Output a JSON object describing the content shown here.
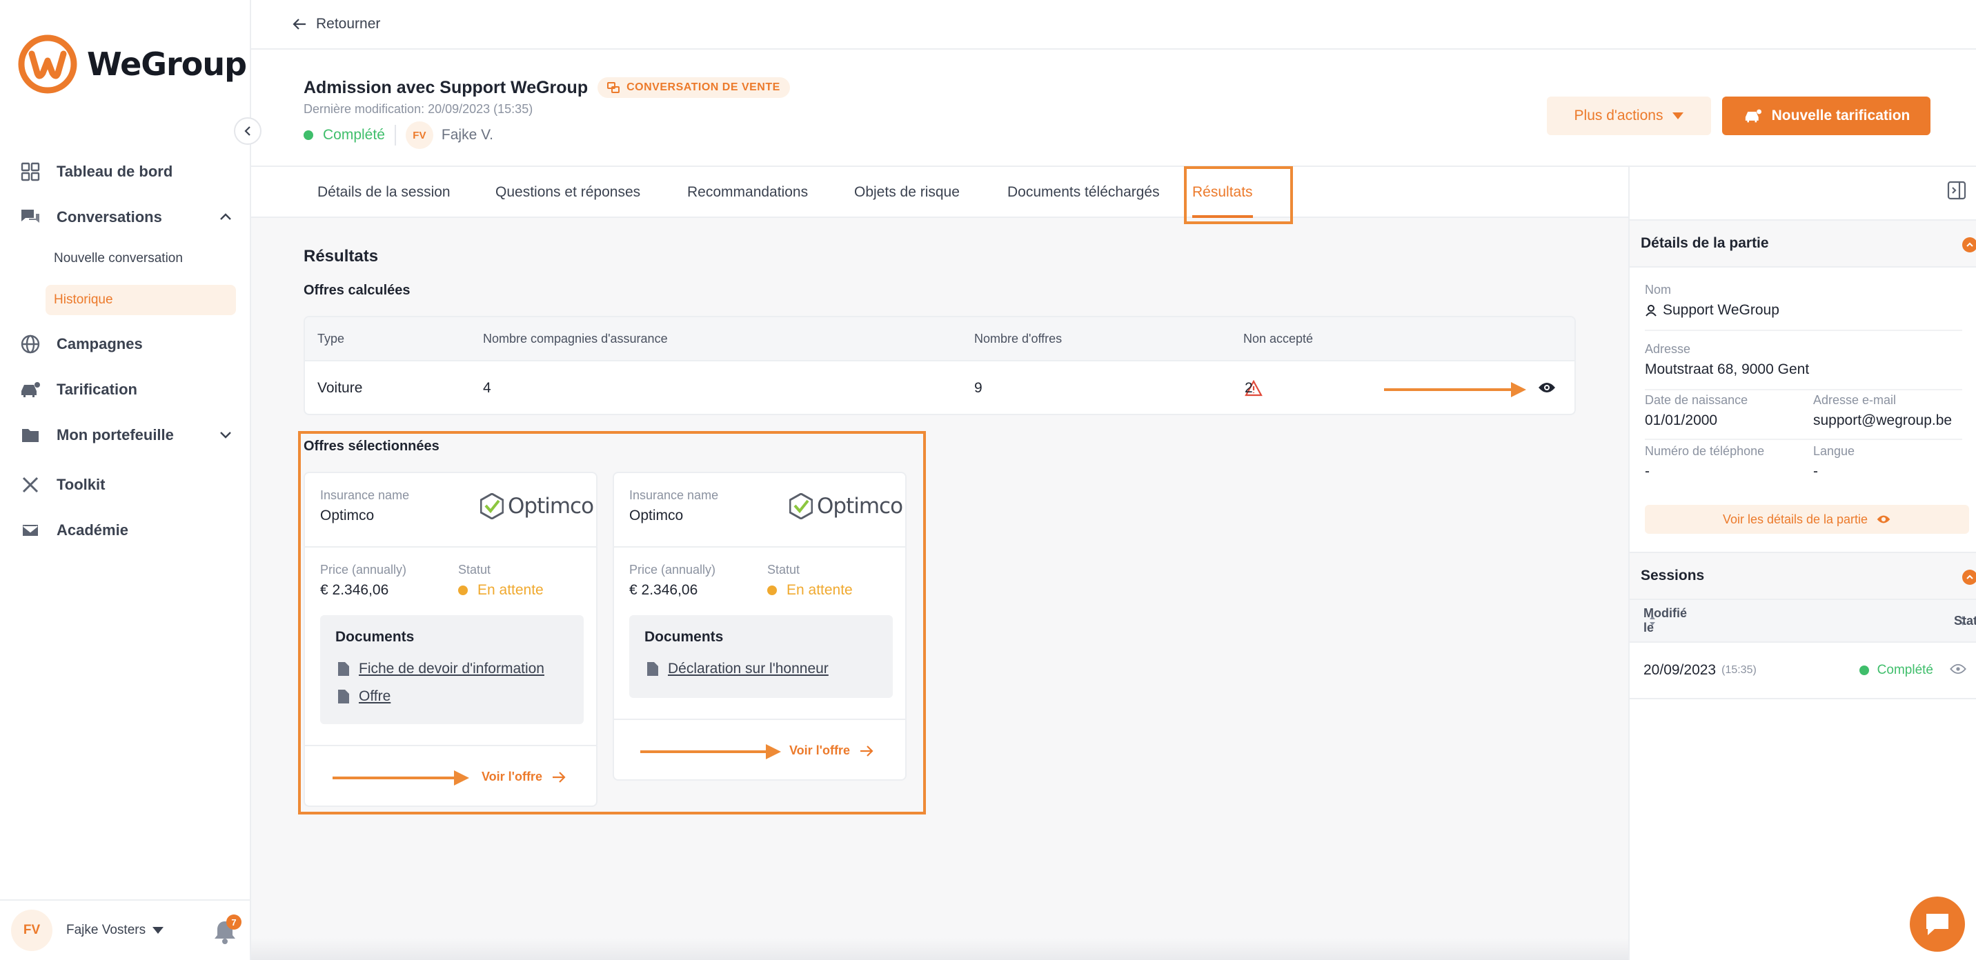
{
  "brand": {
    "name": "WeGroup",
    "accent": "#ec7a2b",
    "success": "#3fbe6b",
    "warning": "#f0a92f",
    "danger": "#e04a3a"
  },
  "sidebar": {
    "items": [
      {
        "label": "Tableau de bord",
        "icon": "dashboard-icon"
      },
      {
        "label": "Conversations",
        "icon": "chat-icon"
      },
      {
        "label": "Campagnes",
        "icon": "globe-icon"
      },
      {
        "label": "Tarification",
        "icon": "car-tag-icon"
      },
      {
        "label": "Mon portefeuille",
        "icon": "folder-icon"
      },
      {
        "label": "Toolkit",
        "icon": "tools-icon"
      },
      {
        "label": "Académie",
        "icon": "mail-icon"
      }
    ],
    "sub_items": [
      {
        "label": "Nouvelle conversation"
      },
      {
        "label": "Historique"
      }
    ],
    "user": {
      "initials": "FV",
      "name": "Fajke Vosters",
      "notifications": "7"
    }
  },
  "topbar": {
    "back_label": "Retourner"
  },
  "header": {
    "title": "Admission avec Support WeGroup",
    "badge": "CONVERSATION DE VENTE",
    "last_modified": "Dernière modification: 20/09/2023 (15:35)",
    "status": "Complété",
    "user_initials": "FV",
    "user_name": "Fajke V.",
    "more_actions": "Plus d'actions",
    "new_quote": "Nouvelle tarification"
  },
  "tabs": [
    {
      "label": "Détails de la session"
    },
    {
      "label": "Questions et réponses"
    },
    {
      "label": "Recommandations"
    },
    {
      "label": "Objets de risque"
    },
    {
      "label": "Documents téléchargés"
    },
    {
      "label": "Résultats",
      "active": true
    }
  ],
  "results": {
    "title": "Résultats",
    "calculated_title": "Offres calculées",
    "table": {
      "headers": [
        "Type",
        "Nombre compagnies d'assurance",
        "Nombre d'offres",
        "Non accepté"
      ],
      "rows": [
        {
          "type": "Voiture",
          "companies": "4",
          "offers": "9",
          "not_accepted": "2"
        }
      ]
    },
    "selected_title": "Offres sélectionnées",
    "cards": [
      {
        "insurance_label": "Insurance name",
        "insurance_name": "Optimco",
        "logo_text": "Optimco",
        "price_label": "Price (annually)",
        "price": "€ 2.346,06",
        "status_label": "Statut",
        "status": "En attente",
        "docs_title": "Documents",
        "documents": [
          "Fiche de devoir d'information",
          "Offre"
        ],
        "cta": "Voir l'offre"
      },
      {
        "insurance_label": "Insurance name",
        "insurance_name": "Optimco",
        "logo_text": "Optimco",
        "price_label": "Price (annually)",
        "price": "€ 2.346,06",
        "status_label": "Statut",
        "status": "En attente",
        "docs_title": "Documents",
        "documents": [
          "Déclaration sur l'honneur"
        ],
        "cta": "Voir l'offre"
      }
    ]
  },
  "party": {
    "section_title": "Détails de la partie",
    "name_label": "Nom",
    "name": "Support WeGroup",
    "address_label": "Adresse",
    "address": "Moutstraat 68, 9000 Gent",
    "dob_label": "Date de naissance",
    "dob": "01/01/2000",
    "email_label": "Adresse e-mail",
    "email": "support@wegroup.be",
    "phone_label": "Numéro de téléphone",
    "phone": "-",
    "lang_label": "Langue",
    "lang": "-",
    "details_button": "Voir les détails de la partie"
  },
  "sessions": {
    "section_title": "Sessions",
    "col_modified": "Modifié le",
    "col_status": "Statut",
    "rows": [
      {
        "date": "20/09/2023",
        "time": "(15:35)",
        "status": "Complété"
      }
    ]
  }
}
